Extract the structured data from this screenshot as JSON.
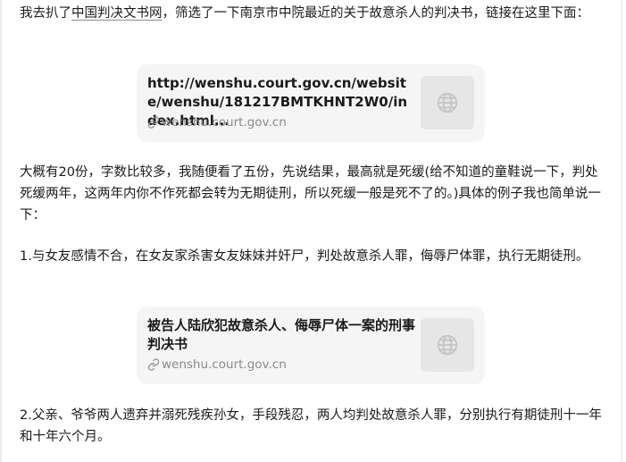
{
  "article": {
    "p1": {
      "before": "我去扒了",
      "link": "中国判决文书网",
      "after": "，筛选了一下南京市中院最近的关于故意杀人的判决书，链接在这里下面："
    },
    "card1": {
      "title": "http://wenshu.court.gov.cn/website/wenshu/181217BMTKHNT2W0/index.html...",
      "source": "wenshu.court.gov.cn",
      "thumb_icon": "globe-icon"
    },
    "p2": "大概有20份，字数比较多，我随便看了五份，先说结果，最高就是死缓(给不知道的童鞋说一下，判处死缓两年，这两年内你不作死都会转为无期徒刑，所以死缓一般是死不了的。)具体的例子我也简单说一下：",
    "p3": "1.与女友感情不合，在女友家杀害女友妹妹并奸尸，判处故意杀人罪，侮辱尸体罪，执行无期徒刑。",
    "card2": {
      "title": "被告人陆欣犯故意杀人、侮辱尸体一案的刑事判决书",
      "source": "wenshu.court.gov.cn",
      "thumb_icon": "globe-icon"
    },
    "p4": "2.父亲、爷爷两人遗弃并溺死残疾孙女，手段残忍，两人均判处故意杀人罪，分别执行有期徒刑十一年和十年六个月。"
  }
}
